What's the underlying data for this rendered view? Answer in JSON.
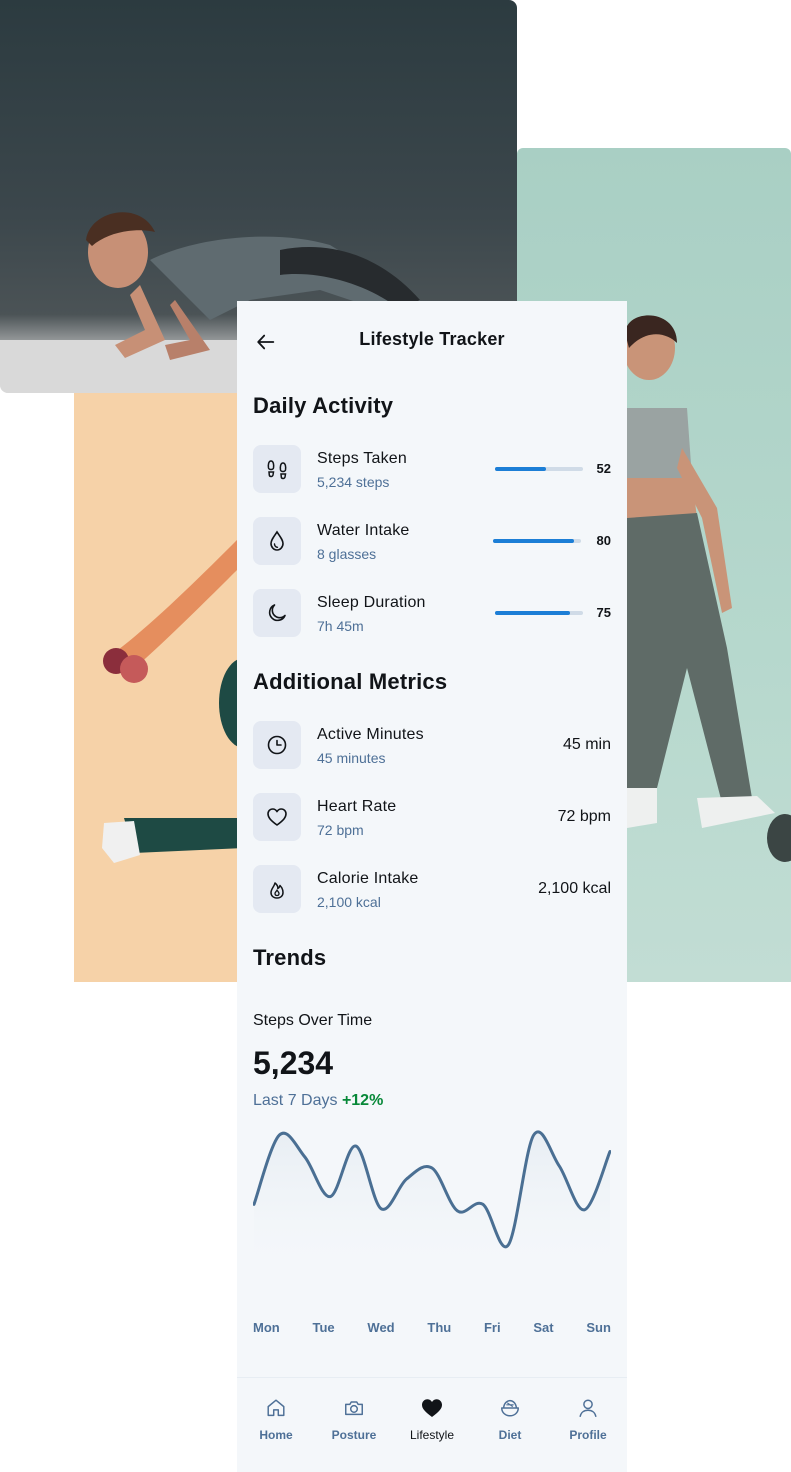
{
  "topbar": {
    "title": "Lifestyle Tracker",
    "back_icon": "arrow-left-icon"
  },
  "daily_activity": {
    "heading": "Daily Activity",
    "items": [
      {
        "title": "Steps Taken",
        "subtitle": "5,234 steps",
        "value": "52",
        "progress": 0.58,
        "icon": "footprints-icon"
      },
      {
        "title": "Water Intake",
        "subtitle": "8 glasses",
        "value": "80",
        "progress": 0.92,
        "icon": "drop-icon"
      },
      {
        "title": "Sleep Duration",
        "subtitle": "7h 45m",
        "value": "75",
        "progress": 0.85,
        "icon": "moon-icon"
      }
    ]
  },
  "additional_metrics": {
    "heading": "Additional Metrics",
    "items": [
      {
        "title": "Active Minutes",
        "subtitle": "45 minutes",
        "value": "45 min",
        "icon": "clock-icon"
      },
      {
        "title": "Heart Rate",
        "subtitle": "72 bpm",
        "value": "72 bpm",
        "icon": "heart-icon"
      },
      {
        "title": "Calorie Intake",
        "subtitle": "2,100 kcal",
        "value": "2,100 kcal",
        "icon": "flame-icon"
      }
    ]
  },
  "trends": {
    "heading": "Trends",
    "chart_title": "Steps Over Time",
    "big_value": "5,234",
    "period": "Last 7 Days",
    "delta": "+12%"
  },
  "chart_data": {
    "type": "line",
    "categories": [
      "Mon",
      "Tue",
      "Wed",
      "Thu",
      "Fri",
      "Sat",
      "Sun"
    ],
    "x": [
      0,
      0.08,
      0.17,
      0.25,
      0.33,
      0.42,
      0.5,
      0.58,
      0.67,
      0.75,
      0.83,
      0.92,
      1
    ],
    "values": [
      37,
      100,
      80,
      44,
      90,
      33,
      60,
      70,
      31,
      37,
      0,
      100,
      72,
      32,
      85
    ],
    "line_color": "#4a6f93",
    "xlabel": "",
    "ylabel": ""
  },
  "bottom_nav": {
    "items": [
      {
        "label": "Home",
        "icon": "home-icon",
        "active": false
      },
      {
        "label": "Posture",
        "icon": "camera-icon",
        "active": false
      },
      {
        "label": "Lifestyle",
        "icon": "heart-filled-icon",
        "active": true
      },
      {
        "label": "Diet",
        "icon": "bowl-icon",
        "active": false
      },
      {
        "label": "Profile",
        "icon": "user-icon",
        "active": false
      }
    ]
  },
  "colors": {
    "accent": "#1c7ed6",
    "muted_text": "#4e7097",
    "positive": "#078838",
    "background": "#f4f7fa"
  }
}
